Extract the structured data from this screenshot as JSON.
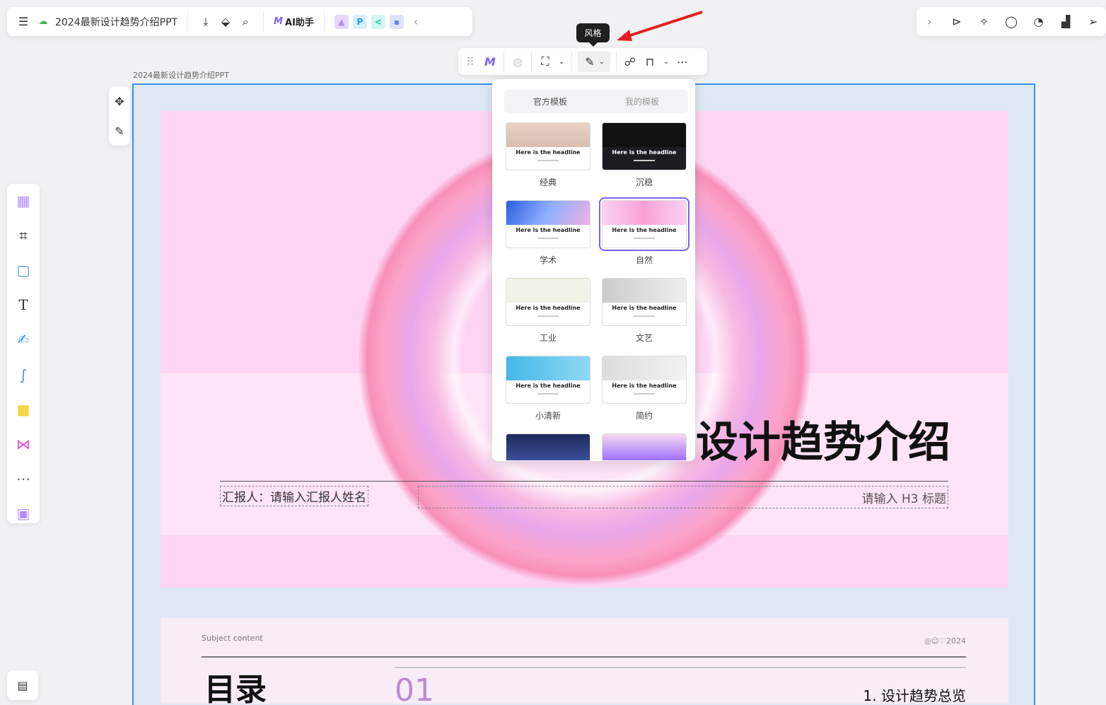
{
  "header": {
    "doc_title": "2024最新设计趋势介绍PPT",
    "ai_label": "AI助手",
    "icons": [
      "menu-icon",
      "cloud-sync-icon",
      "download-icon",
      "tag-icon",
      "search-icon",
      "ai-logo-icon",
      "image-app-icon",
      "p-app-icon",
      "mindmap-app-icon",
      "chat-app-icon",
      "collapse-icon"
    ]
  },
  "right_toolbar": {
    "icons": [
      "expand-icon",
      "play-icon",
      "celebrate-icon",
      "comment-icon",
      "timer-icon",
      "chart-icon",
      "pointer-icon"
    ]
  },
  "float_toolbar": {
    "tooltip": "风格",
    "icons": [
      "drag-handle-icon",
      "ai-logo-icon",
      "transparent-fill-icon",
      "presentation-icon",
      "style-brush-icon",
      "share-nodes-icon",
      "unlock-icon",
      "more-icon"
    ]
  },
  "canvas": {
    "label": "2024最新设计趋势介绍PPT"
  },
  "slide1": {
    "title": "设计趋势介绍",
    "reporter": "汇报人：请输入汇报人姓名",
    "h3": "请输入 H3 标题",
    "bg": "#fdd4f2"
  },
  "slide2": {
    "subject": "Subject content",
    "year": "2024",
    "heading": "目录",
    "number": "01",
    "item": "1. 设计趋势总览"
  },
  "panel": {
    "tabs": [
      "官方模板",
      "我的模板"
    ],
    "templates": [
      {
        "name": "经典",
        "headline": "Here is the headline",
        "selected": false
      },
      {
        "name": "沉稳",
        "headline": "Here is the headline",
        "selected": false
      },
      {
        "name": "学术",
        "headline": "Here is the headline",
        "selected": false
      },
      {
        "name": "自然",
        "headline": "Here is the headline",
        "selected": true
      },
      {
        "name": "工业",
        "headline": "Here is the headline",
        "selected": false
      },
      {
        "name": "文艺",
        "headline": "Here is the headline",
        "selected": false
      },
      {
        "name": "小清新",
        "headline": "Here is the headline",
        "selected": false
      },
      {
        "name": "简约",
        "headline": "Here is the headline",
        "selected": false
      }
    ]
  },
  "left_tools": [
    "template-icon",
    "frame-icon",
    "shape-icon",
    "text-icon",
    "pen-icon",
    "connector-icon",
    "sticky-note-icon",
    "mindmap-icon",
    "more-icon",
    "plugin-icon"
  ],
  "accent": "#3c8ff0"
}
